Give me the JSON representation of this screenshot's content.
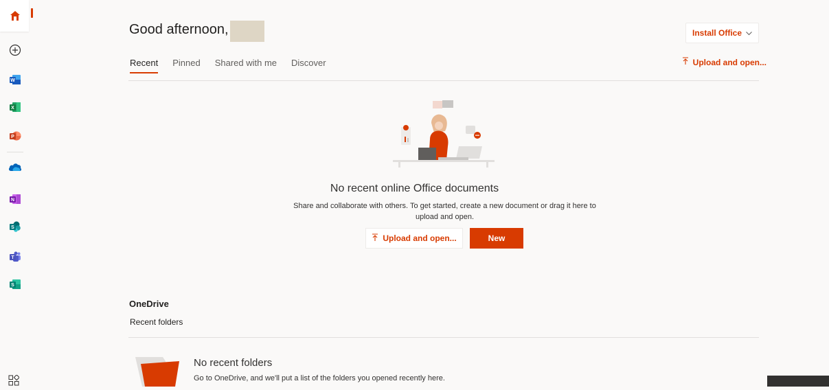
{
  "header": {
    "greeting": "Good afternoon,",
    "install_label": "Install Office",
    "upload_label": "Upload and open..."
  },
  "tabs": [
    "Recent",
    "Pinned",
    "Shared with me",
    "Discover"
  ],
  "empty_state": {
    "title": "No recent online Office documents",
    "description": "Share and collaborate with others. To get started, create a new document or drag it here to upload and open.",
    "upload_label": "Upload and open...",
    "new_label": "New"
  },
  "onedrive": {
    "title": "OneDrive",
    "subtitle": "Recent folders",
    "empty_title": "No recent folders",
    "empty_desc": "Go to OneDrive, and we'll put a list of the folders you opened recently here."
  },
  "rail": {
    "icons": [
      "home-icon",
      "create-icon",
      "word-icon",
      "excel-icon",
      "powerpoint-icon",
      "onedrive-icon",
      "onenote-icon",
      "sharepoint-icon",
      "teams-icon",
      "sway-icon",
      "all-apps-icon"
    ]
  },
  "colors": {
    "accent": "#d83b01",
    "background": "#faf9f8"
  }
}
